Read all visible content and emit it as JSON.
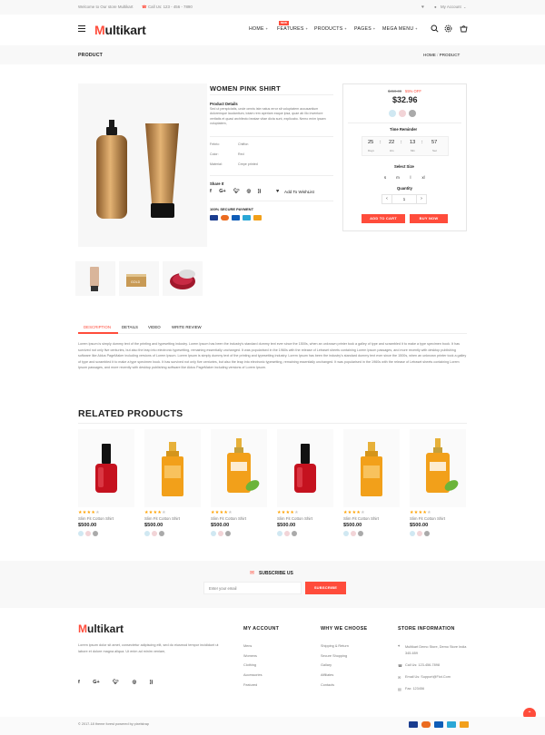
{
  "topbar": {
    "welcome": "Welcome to Our store Multikart",
    "call": "Call Us: 123 - 456 - 7890",
    "account": "My Account"
  },
  "header": {
    "logo_m": "M",
    "logo_rest": "ultikart",
    "nav": [
      {
        "label": "HOME"
      },
      {
        "label": "FEATURES",
        "badge": "NEW"
      },
      {
        "label": "PRODUCTS"
      },
      {
        "label": "PAGES"
      },
      {
        "label": "MEGA MENU"
      }
    ]
  },
  "breadcrumb": {
    "title": "PRODUCT",
    "path_home": "HOME",
    "path_sep": "/",
    "path_current": "PRODUCT"
  },
  "product": {
    "name": "WOMEN PINK SHIRT",
    "details_heading": "Product Details",
    "details_text": "Sed ut perspiciatis, unde omnis iste natus error sit voluptatem accusantium doloremque laudantium, totam rem aperiam eaque ipsa, quae ab illo inventore veritatis et quasi architecto beatae vitae dicta sunt, explicabo. Nemo enim ipsam voluptatem,",
    "specs": [
      {
        "label": "Febric:",
        "value": "Chiffon"
      },
      {
        "label": "Color:",
        "value": "Red"
      },
      {
        "label": "Material:",
        "value": "Crepe printed"
      }
    ],
    "share_label": "Share It",
    "wishlist": "Add To WishList",
    "secure": "100% SECURE PAYMENT"
  },
  "buybox": {
    "old_price": "$459.00",
    "discount": "55% OFF",
    "price": "$32.96",
    "colors": [
      "#d0e8f2",
      "#f2d4d7",
      "#aaaaaa"
    ],
    "timer_heading": "Time Reminder",
    "timer": [
      {
        "value": "25",
        "unit": "Days"
      },
      {
        "value": "22",
        "unit": "Hrs"
      },
      {
        "value": "13",
        "unit": "Min"
      },
      {
        "value": "57",
        "unit": "Sec"
      }
    ],
    "size_heading": "Select Size",
    "sizes": [
      "s",
      "m",
      "l",
      "xl"
    ],
    "qty_heading": "Quantity",
    "qty": "1",
    "qty_minus": "‹",
    "qty_plus": "›",
    "add_to_cart": "ADD TO CART",
    "buy_now": "BUY NOW"
  },
  "tabs": [
    "DESCRIPTION",
    "DETAILS",
    "VIDEO",
    "WRITE REVIEW"
  ],
  "description": "Lorem Ipsum is simply dummy text of the printing and typesetting industry. Lorem Ipsum has been the industry's standard dummy text ever since the 1500s, when an unknown printer took a galley of type and scrambled it to make a type specimen book. It has survived not only five centuries, but also the leap into electronic typesetting, remaining essentially unchanged. It was popularised in the 1960s with the release of Letraset sheets containing Lorem Ipsum passages, and more recently with desktop publishing software like Aldus PageMaker including versions of Lorem Ipsum. Lorem Ipsum is simply dummy text of the printing and typesetting industry. Lorem Ipsum has been the industry's standard dummy text ever since the 1500s, when an unknown printer took a galley of type and scrambled it to make a type specimen book. It has survived not only five centuries, but also the leap into electronic typesetting, remaining essentially unchanged. It was popularised in the 1960s with the release of Letraset sheets containing Lorem Ipsum passages, and more recently with desktop publishing software like Aldus PageMaker including versions of Lorem Ipsum.",
  "related": {
    "heading": "RELATED PRODUCTS",
    "items": [
      {
        "name": "Slim Fit Cotton Shirt",
        "price": "$500.00",
        "image": "nail-polish-icon",
        "rating": 4
      },
      {
        "name": "Slim Fit Cotton Shirt",
        "price": "$500.00",
        "image": "oil-bottle-icon",
        "rating": 4
      },
      {
        "name": "Slim Fit Cotton Shirt",
        "price": "$500.00",
        "image": "serum-bottle-icon",
        "rating": 4
      },
      {
        "name": "Slim Fit Cotton Shirt",
        "price": "$500.00",
        "image": "nail-polish-icon",
        "rating": 4
      },
      {
        "name": "Slim Fit Cotton Shirt",
        "price": "$500.00",
        "image": "oil-bottle-icon",
        "rating": 4
      },
      {
        "name": "Slim Fit Cotton Shirt",
        "price": "$500.00",
        "image": "serum-bottle-icon",
        "rating": 4
      }
    ],
    "swatches": [
      "#d0e8f2",
      "#f2d4d7",
      "#aaaaaa"
    ]
  },
  "subscribe": {
    "heading": "SUBSCRIBE US",
    "placeholder": "Enter your email",
    "button": "SUBSCRIBE"
  },
  "footer": {
    "about": "Lorem ipsum dolor sit amet, consectetur adipiscing elit, sed do eiusmod tempor incididunt ut labore et dolore magna aliqua. Ut enim ad minim veniam,",
    "my_account": {
      "heading": "MY ACCOUNT",
      "links": [
        "Mens",
        "Womens",
        "Clothing",
        "Accessories",
        "Featured"
      ]
    },
    "why": {
      "heading": "WHY WE CHOOSE",
      "links": [
        "Shipping & Return",
        "Secure Shopping",
        "Gallary",
        "Affiliates",
        "Contacts"
      ]
    },
    "store": {
      "heading": "STORE INFORMATION",
      "address": "Multikart Demo Store, Demo Store India 345-659",
      "call": "Call Us: 123-456-7898",
      "email": "Email Us: Support@Fiot.Com",
      "fax": "Fax: 123456"
    },
    "copyright": "© 2017-18 theme forest powered by pixelstrap"
  },
  "colors": {
    "accent": "#ff4c3b",
    "gold": "#c89a55",
    "orange": "#f2a01a"
  }
}
